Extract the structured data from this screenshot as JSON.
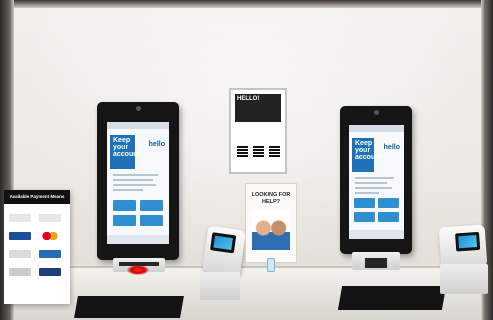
{
  "scene": {
    "description_colors": {
      "wall": "#ece9e4",
      "kiosk_bezel": "#151515",
      "screen_accent": "#1f72b8",
      "indicator_red": "#e00000"
    }
  },
  "left_kiosk": {
    "hero_text": "Keep your account",
    "hero_side_text": "hello",
    "camera": "camera-icon"
  },
  "right_kiosk": {
    "hero_text": "Keep your account",
    "hero_side_text": "hello",
    "camera": "camera-icon"
  },
  "wall_poster": {
    "heading": "HELLO!"
  },
  "standee": {
    "heading": "LOOKING FOR HELP?"
  },
  "payment_sign": {
    "heading": "Available Payment Means"
  }
}
